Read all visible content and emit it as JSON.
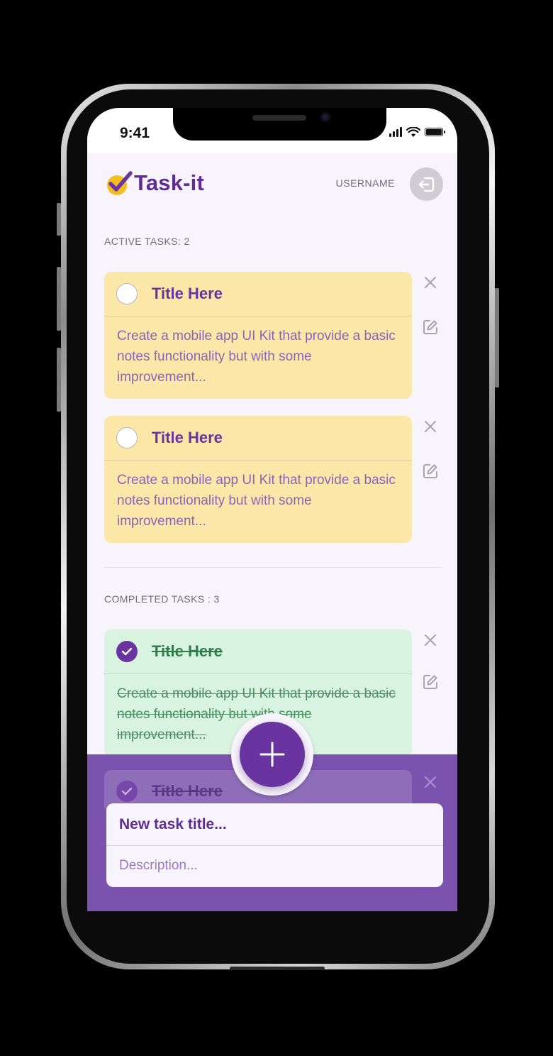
{
  "status_bar": {
    "time": "9:41"
  },
  "header": {
    "app_name": "Task-it",
    "username": "USERNAME",
    "logout_icon": "logout-icon"
  },
  "active_section": {
    "label": "ACTIVE TASKS: 2",
    "tasks": [
      {
        "title": "Title Here",
        "description": "Create a mobile app UI Kit that provide a basic notes functionality but with some improvement...",
        "completed": false
      },
      {
        "title": "Title Here",
        "description": "Create a mobile app UI Kit that provide a basic notes functionality but with some improvement...",
        "completed": false
      }
    ]
  },
  "completed_section": {
    "label": "COMPLETED TASKS : 3",
    "tasks": [
      {
        "title": "Title Here",
        "description": "Create a mobile app UI Kit that provide a basic notes functionality but with some improvement...",
        "completed": true
      },
      {
        "title": "Title Here",
        "completed": true
      }
    ]
  },
  "new_task": {
    "title_placeholder": "New task title...",
    "description_placeholder": "Description..."
  },
  "colors": {
    "brand_purple": "#6a34a0",
    "active_card": "#fbe8a9",
    "completed_card": "#d8f4e0",
    "sheet": "#7b52ae",
    "logo_yellow": "#f2be22"
  },
  "icons": {
    "delete": "close-icon",
    "edit": "edit-icon",
    "add": "plus-icon",
    "check": "check-icon"
  }
}
